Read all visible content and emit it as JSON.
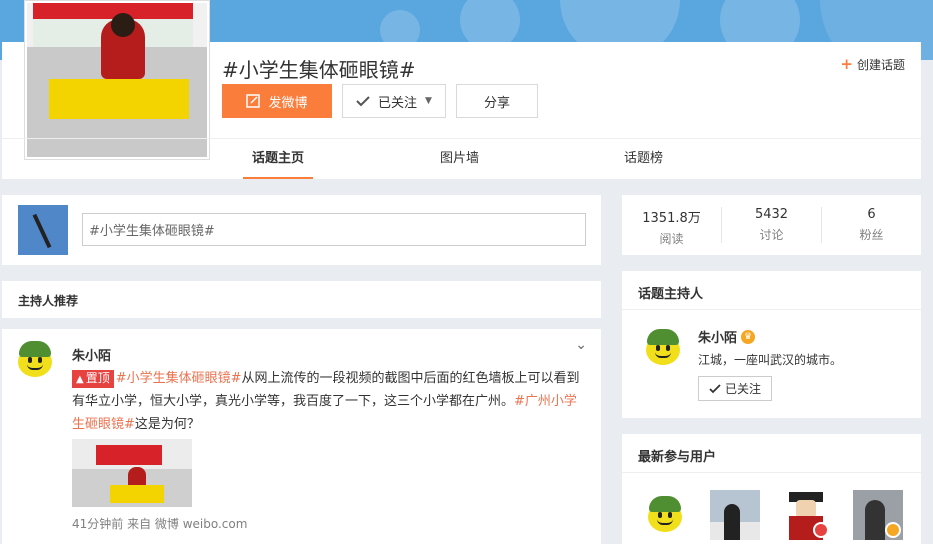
{
  "topic": {
    "title": "#小学生集体砸眼镜#",
    "create_topic_label": "创建话题"
  },
  "actions": {
    "post_label": "发微博",
    "follow_label": "已关注",
    "share_label": "分享"
  },
  "tabs": [
    {
      "label": "话题主页",
      "active": true
    },
    {
      "label": "图片墙",
      "active": false
    },
    {
      "label": "话题榜",
      "active": false
    }
  ],
  "composer": {
    "value": "#小学生集体砸眼镜#"
  },
  "recommend": {
    "title": "主持人推荐"
  },
  "post": {
    "author": "朱小陌",
    "pin_label": "置顶",
    "hashtag1": "#小学生集体砸眼镜#",
    "text1": "从网上流传的一段视频的截图中后面的红色墙板上可以看到有华立小学，恒大小学，真光小学等，我百度了一下，这三个小学都在广州。",
    "hashtag2": "#广州小学生砸眼镜#",
    "text2": "这是为何？",
    "meta": "41分钟前 来自 微博 weibo.com"
  },
  "stats": [
    {
      "value": "1351.8万",
      "label": "阅读"
    },
    {
      "value": "5432",
      "label": "讨论"
    },
    {
      "value": "6",
      "label": "粉丝"
    }
  ],
  "host": {
    "title": "话题主持人",
    "name": "朱小陌",
    "bio": "江城，一座叫武汉的城市。",
    "follow_label": "已关注"
  },
  "users": {
    "title": "最新参与用户"
  },
  "colors": {
    "accent": "#fa7d3c",
    "hashtag": "#eb7350",
    "pin": "#e64340"
  }
}
